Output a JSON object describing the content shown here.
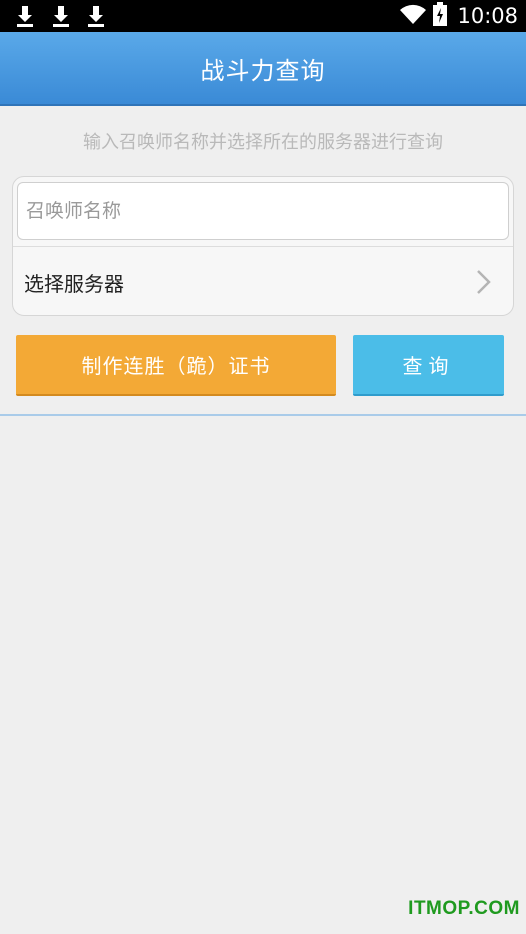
{
  "status_bar": {
    "time": "10:08",
    "notifications": [
      "download-icon",
      "download-icon",
      "download-icon"
    ],
    "icons": [
      "wifi-icon",
      "battery-charging-icon"
    ]
  },
  "header": {
    "title": "战斗力查询"
  },
  "form": {
    "hint": "输入召唤师名称并选择所在的服务器进行查询",
    "name_placeholder": "召唤师名称",
    "name_value": "",
    "server_label": "选择服务器"
  },
  "actions": {
    "certificate_label": "制作连胜（跪）证书",
    "query_label": "查询"
  },
  "watermark": "ITMOP.COM",
  "colors": {
    "header": "#3f92db",
    "certificate_button": "#f3a936",
    "query_button": "#4bbde8",
    "background": "#efefef",
    "watermark": "#1f9a1f"
  }
}
